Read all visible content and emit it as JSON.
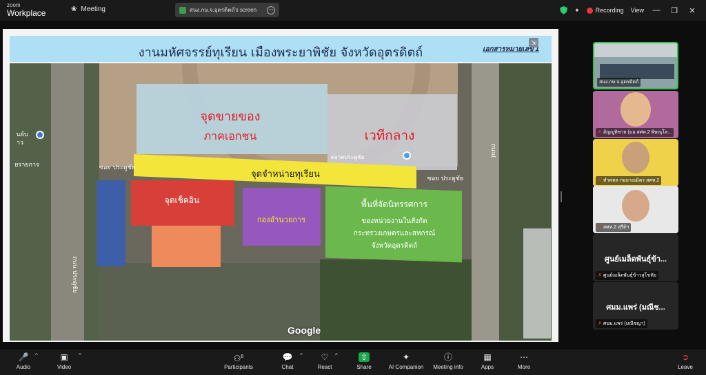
{
  "app": {
    "brand_line1": "zoom",
    "brand_line2": "Workplace",
    "meeting_label": "Meeting",
    "screen_share_label": "สนง.กษ.จ.อุตรดิตถ์'s screen",
    "recording_label": "Recording",
    "view_label": "View"
  },
  "slide": {
    "title": "งานมหัศจรรย์ทุเรียน เมืองพระยาพิชัย จังหวัดอุตรดิตถ์",
    "doc_tag": "เอกสารหมายเลข 1",
    "zones": {
      "private_sales_line1": "จุดขายของ",
      "private_sales_line2": "ภาคเอกชน",
      "center_stage": "เวทีกลาง",
      "durian_sales": "จุดจำหน่ายทุเรียน",
      "check_in": "จุดเช็คอิน",
      "directorate": "กองอำนวยการ",
      "exhibit_line1": "พื้นที่จัดนิทรรศการ",
      "exhibit_line2": "ของหน่วยงานในสังกัด",
      "exhibit_line3": "กระทรวงเกษตรและสหกรณ์",
      "exhibit_line4": "จังหวัดอุตรดิตถ์"
    },
    "map_labels": {
      "soi_left": "ซอย ประตูชัย",
      "soi_right": "ซอย ประตูชัย",
      "road_vertical_left": "ถนน ประตูชัย",
      "road_vertical_right": "ถนน(",
      "poi_left_1": "นย์บ",
      "poi_left_2": "าว",
      "poi_left_3": "ยรายการ",
      "market": "ตลาดประตูชัย",
      "google": "Google"
    }
  },
  "participants": [
    {
      "name": "สนง.กษ.จ.อุตรดิตถ์",
      "muted": false
    },
    {
      "name": "อัญญูทิชาย (มอ.สศท.2 พิษณุโล...",
      "muted": true
    },
    {
      "name": "ทำพหล กษยาณมิตร สศท.2",
      "muted": true
    },
    {
      "name": "สศท.2 สุรีย์ฯ",
      "muted": true
    },
    {
      "name": "ศูนย์เมล็ดพันธุ์ข้าวสุโขทัย",
      "big": "ศูนย์เมล็ดพันธุ์ข้า...",
      "muted": true
    },
    {
      "name": "ศมม.แพร่ (มณีชญา)",
      "big": "ศมม.แพร่ (มณีช...",
      "muted": true
    }
  ],
  "toolbar": {
    "audio": "Audio",
    "video": "Video",
    "participants": "Participants",
    "participants_count": "6",
    "chat": "Chat",
    "react": "React",
    "share": "Share",
    "ai_companion": "AI Companion",
    "meeting_info": "Meeting info",
    "apps": "Apps",
    "more": "More",
    "leave": "Leave"
  },
  "colors": {
    "private_zone": "#b9d5e1",
    "stage_zone": "#c9c9cf",
    "durian_band": "#f4e53a",
    "checkin": "#e23c35",
    "directorate": "#9b57c7",
    "exhibit": "#6cc24a",
    "zone_text_red": "#e21c23",
    "accent_green": "#19a54a",
    "recording_red": "#e5383b"
  }
}
